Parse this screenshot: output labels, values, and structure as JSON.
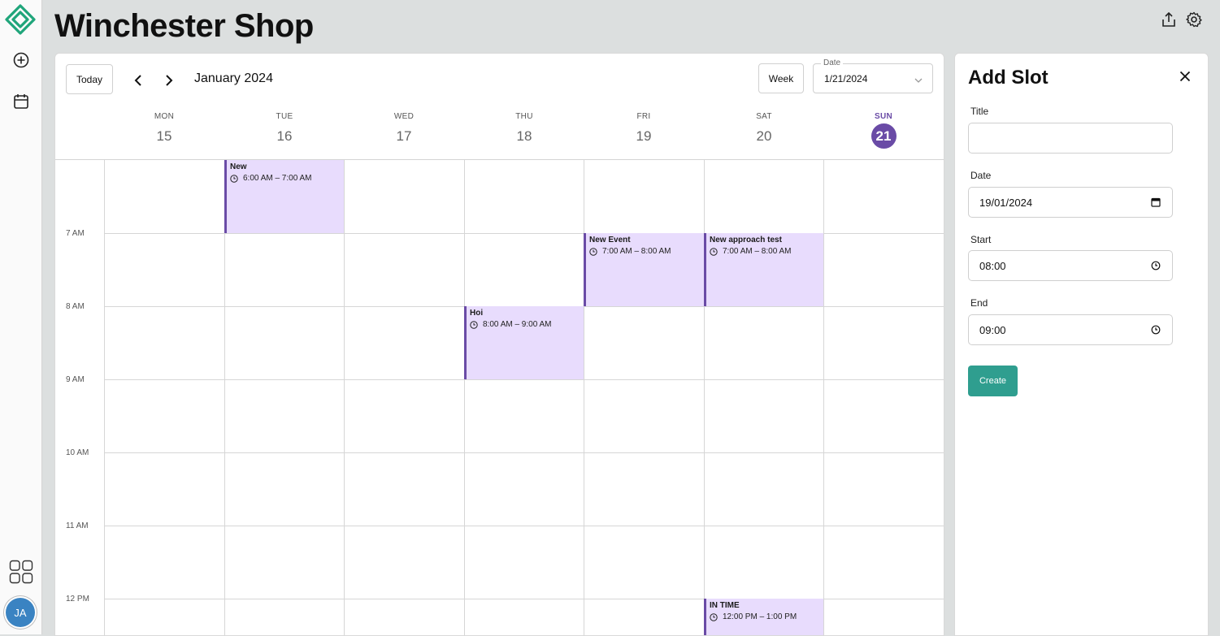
{
  "app": {
    "title": "Winchester Shop",
    "avatar_initials": "JA",
    "accent": "#6a4ba6",
    "logo_color": "#1fa57a"
  },
  "rail": {
    "icons": [
      "logo-icon",
      "add-circle-icon",
      "calendar-icon",
      "apps-grid-icon"
    ]
  },
  "header": {
    "icons": [
      "share-icon",
      "gear-icon"
    ]
  },
  "toolbar": {
    "today_label": "Today",
    "month_label": "January 2024",
    "view_label": "Week",
    "date_legend": "Date",
    "date_value": "1/21/2024"
  },
  "days": [
    {
      "name": "MON",
      "num": "15"
    },
    {
      "name": "TUE",
      "num": "16"
    },
    {
      "name": "WED",
      "num": "17"
    },
    {
      "name": "THU",
      "num": "18"
    },
    {
      "name": "FRI",
      "num": "19"
    },
    {
      "name": "SAT",
      "num": "20"
    },
    {
      "name": "SUN",
      "num": "21"
    }
  ],
  "hours": [
    "7 AM",
    "8 AM",
    "9 AM",
    "10 AM",
    "11 AM",
    "12 PM"
  ],
  "events": [
    {
      "title": "New",
      "time": "6:00 AM – 7:00 AM",
      "day": "TUE"
    },
    {
      "title": "New Event",
      "time": "7:00 AM – 8:00 AM",
      "day": "FRI"
    },
    {
      "title": "New approach test",
      "time": "7:00 AM – 8:00 AM",
      "day": "SAT"
    },
    {
      "title": "Hoi",
      "time": "8:00 AM – 9:00 AM",
      "day": "THU"
    },
    {
      "title": "IN TIME",
      "time": "12:00 PM – 1:00 PM",
      "day": "SAT"
    }
  ],
  "event_color": "#e8dcfd",
  "panel": {
    "title": "Add Slot",
    "title_label": "Title",
    "title_value": "",
    "date_label": "Date",
    "date_value": "19/01/2024",
    "start_label": "Start",
    "start_value": "08:00",
    "end_label": "End",
    "end_value": "09:00",
    "create_label": "Create",
    "create_color": "#2f9e8f"
  }
}
